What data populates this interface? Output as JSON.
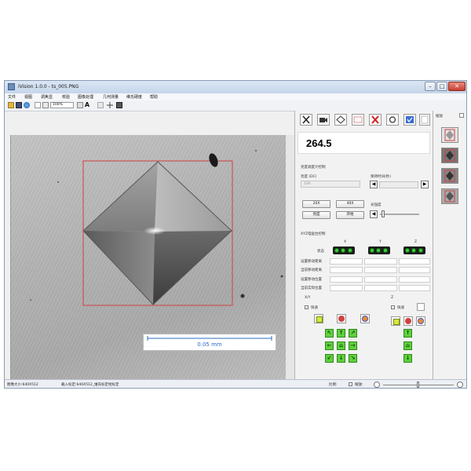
{
  "window": {
    "title": "iVision 1.0.0 - ts_005.PNG",
    "controls": {
      "minimize": "–",
      "maximize": "□",
      "close": "✕"
    }
  },
  "menu": [
    "文件",
    "视图",
    "调焦显",
    "校验",
    "图像处理",
    "几何测量",
    "维氏硬度",
    "帮助"
  ],
  "toolbar": {
    "zoom": "100%",
    "text_tool": "A"
  },
  "scale_bar": {
    "label": "0.05 mm"
  },
  "measurement": {
    "value": "264.5"
  },
  "lighting": {
    "section_title": "亮度调度计控制",
    "mode_label": "亮度 (DC)",
    "mode_value": "100",
    "time_label": "保持时间(秒)",
    "btn_20x": "20X",
    "btn_40x": "40X",
    "btn_auto": "亮度",
    "btn_start": "开始",
    "brightness_label": "光强度"
  },
  "xyz": {
    "section_title": "XYZ电驱台控制",
    "axis_x": "X",
    "axis_y": "Y",
    "axis_z": "Z",
    "status_label": "状态",
    "rows": [
      "设置移动距离",
      "当前移动距离",
      "设置移动位置",
      "当前实际位置"
    ]
  },
  "move_xy": {
    "title": "X/Y",
    "check_label": "快速"
  },
  "move_z": {
    "title": "Z",
    "check_label": "快速"
  },
  "status": {
    "left": "图像大小:640X512",
    "middle": "载入标定:640X512_维氏标定经标定",
    "right_label": "比例:",
    "right_zoom_label": "缩放:"
  },
  "thumbs": {
    "title": "缩放"
  },
  "colors": {
    "accent": "#2b6fc7",
    "roi": "#d04040",
    "green": "#5fcf3c"
  }
}
